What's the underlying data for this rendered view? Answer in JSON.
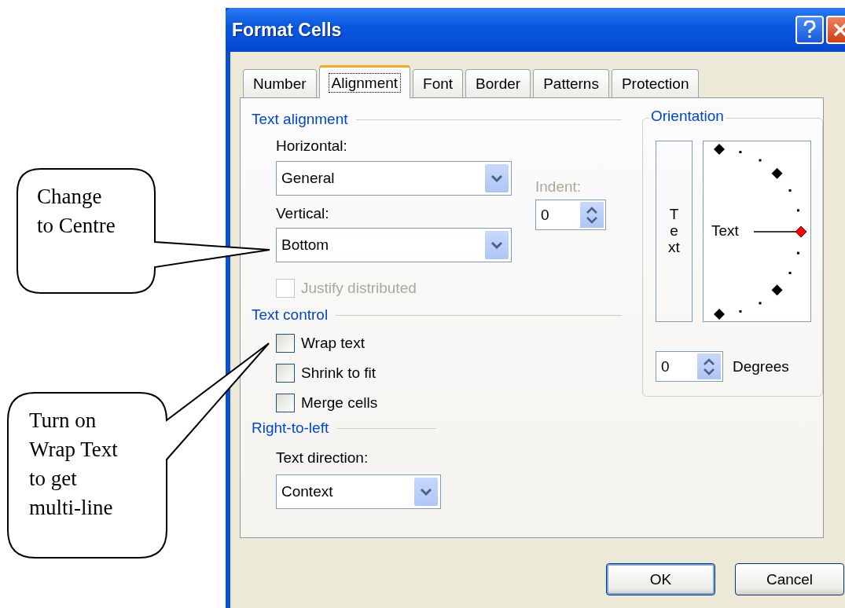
{
  "window": {
    "title": "Format Cells"
  },
  "tabs": [
    {
      "label": "Number",
      "selected": false
    },
    {
      "label": "Alignment",
      "selected": true
    },
    {
      "label": "Font",
      "selected": false
    },
    {
      "label": "Border",
      "selected": false
    },
    {
      "label": "Patterns",
      "selected": false
    },
    {
      "label": "Protection",
      "selected": false
    }
  ],
  "text_alignment": {
    "heading": "Text alignment",
    "horizontal": {
      "label": "Horizontal:",
      "value": "General"
    },
    "vertical": {
      "label": "Vertical:",
      "value": "Bottom"
    },
    "indent": {
      "label": "Indent:",
      "value": "0",
      "disabled": true
    },
    "justify_distributed": {
      "label": "Justify distributed",
      "checked": false,
      "disabled": true
    }
  },
  "text_control": {
    "heading": "Text control",
    "options": [
      {
        "label": "Wrap text",
        "checked": false
      },
      {
        "label": "Shrink to fit",
        "checked": false
      },
      {
        "label": "Merge cells",
        "checked": false
      }
    ]
  },
  "right_to_left": {
    "heading": "Right-to-left",
    "direction": {
      "label": "Text direction:",
      "value": "Context"
    }
  },
  "orientation": {
    "heading": "Orientation",
    "vertical_text": "Text",
    "dial_text": "Text",
    "degrees": {
      "value": "0",
      "label": "Degrees"
    }
  },
  "buttons": [
    {
      "label": "OK",
      "default": true
    },
    {
      "label": "Cancel",
      "default": false
    }
  ],
  "callouts": [
    {
      "lines": [
        "Change",
        "to Centre"
      ]
    },
    {
      "lines": [
        "Turn on",
        "Wrap Text",
        "to get",
        "multi-line"
      ]
    }
  ]
}
